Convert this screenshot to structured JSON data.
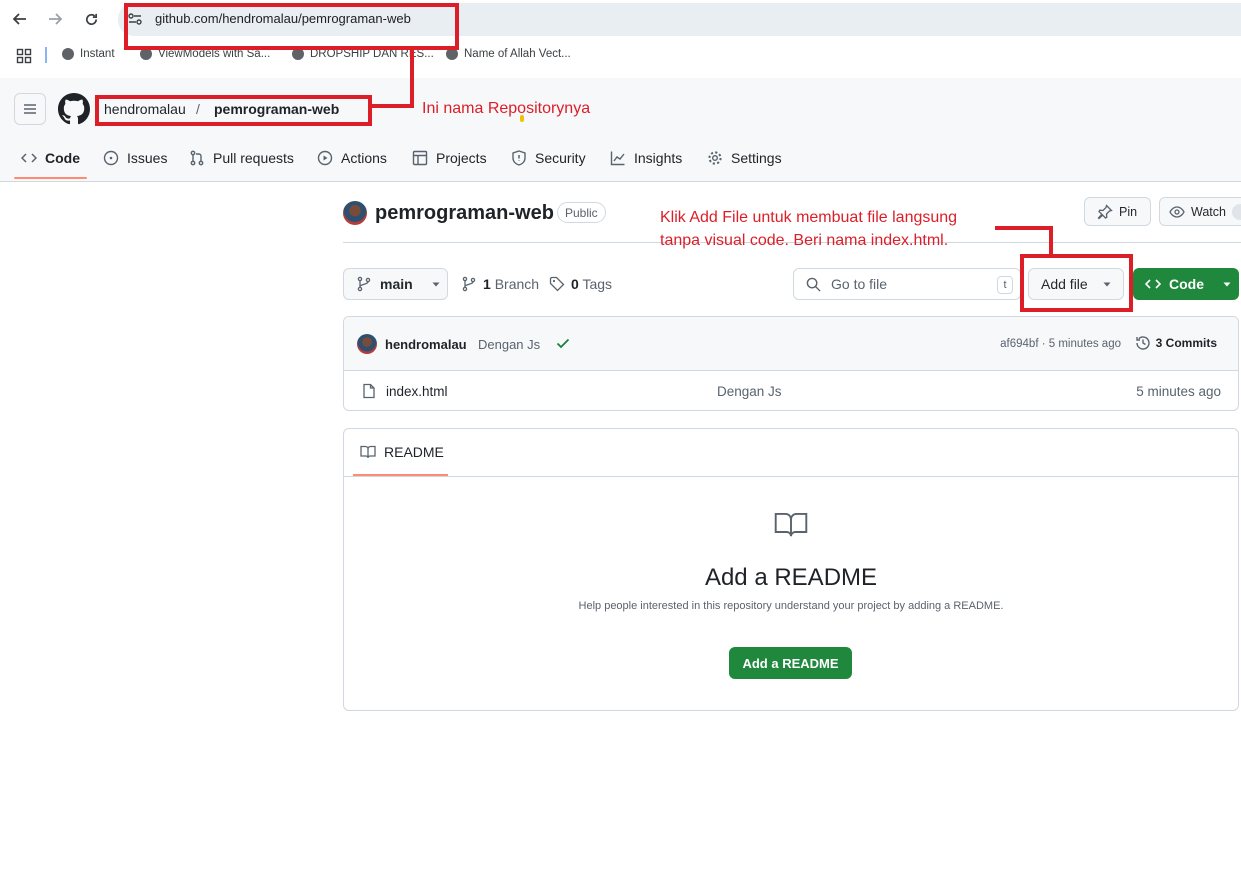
{
  "browser": {
    "url": "github.com/hendromalau/pemrograman-web",
    "bookmarks": [
      {
        "label": "Instant"
      },
      {
        "label": "ViewModels with Sa..."
      },
      {
        "label": "DROPSHIP DAN RES..."
      },
      {
        "label": "Name of Allah Vect..."
      }
    ]
  },
  "header": {
    "owner": "hendromalau",
    "separator": "/",
    "repo": "pemrograman-web",
    "tabs": [
      {
        "label": "Code",
        "icon": "code-icon"
      },
      {
        "label": "Issues",
        "icon": "issue-icon"
      },
      {
        "label": "Pull requests",
        "icon": "pull-request-icon"
      },
      {
        "label": "Actions",
        "icon": "play-icon"
      },
      {
        "label": "Projects",
        "icon": "table-icon"
      },
      {
        "label": "Security",
        "icon": "shield-icon"
      },
      {
        "label": "Insights",
        "icon": "graph-icon"
      },
      {
        "label": "Settings",
        "icon": "gear-icon"
      }
    ]
  },
  "repo": {
    "title": "pemrograman-web",
    "visibility": "Public",
    "pin_label": "Pin",
    "watch_label": "Watch"
  },
  "file_nav": {
    "branch": "main",
    "branch_count": "1",
    "branch_label": "Branch",
    "tag_count": "0",
    "tag_label": "Tags",
    "search_placeholder": "Go to file",
    "search_shortcut": "t",
    "add_file_label": "Add file",
    "code_label": "Code"
  },
  "latest_commit": {
    "author": "hendromalau",
    "message": "Dengan Js",
    "status": "success",
    "hash_time": "af694bf · 5 minutes ago",
    "commits_label": "3 Commits"
  },
  "files": [
    {
      "name": "index.html",
      "message": "Dengan Js",
      "time": "5 minutes ago",
      "icon": "file-icon"
    }
  ],
  "readme": {
    "tab_label": "README",
    "heading": "Add a README",
    "subtext": "Help people interested in this repository understand your project by adding a README.",
    "button_label": "Add a README"
  },
  "annotations": {
    "repo_note": "Ini nama Repositorynya",
    "add_file_note_line1": "Klik Add File untuk membuat file langsung",
    "add_file_note_line2": "tanpa visual code. Beri nama index.html.",
    "color": "#dc1e28"
  },
  "colors": {
    "primary_green": "#1f883d",
    "tab_underline": "#fd8c73",
    "annotation_red": "#dc1e28"
  }
}
